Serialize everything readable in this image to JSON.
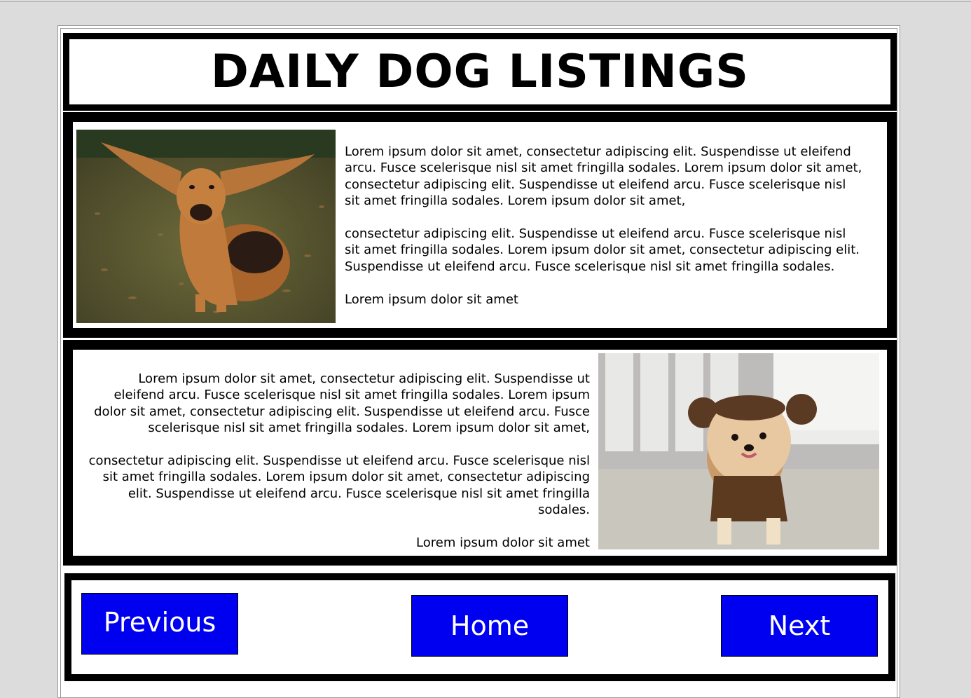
{
  "header": {
    "title": "DAILY DOG LISTINGS"
  },
  "listings": [
    {
      "image": "bloodhound-long-ears-photo",
      "paragraphs": [
        "Lorem ipsum dolor sit amet, consectetur adipiscing elit. Suspendisse ut eleifend arcu. Fusce scelerisque nisl sit amet fringilla sodales. Lorem ipsum dolor sit amet, consectetur adipiscing elit. Suspendisse ut eleifend arcu. Fusce scelerisque nisl sit amet fringilla sodales. Lorem ipsum dolor sit amet,",
        "consectetur adipiscing elit. Suspendisse ut eleifend arcu. Fusce scelerisque nisl sit amet fringilla sodales. Lorem ipsum dolor sit amet, consectetur adipiscing elit. Suspendisse ut eleifend arcu. Fusce scelerisque nisl sit amet fringilla sodales.",
        "Lorem ipsum dolor sit amet"
      ]
    },
    {
      "image": "pomeranian-in-costume-photo",
      "paragraphs": [
        "Lorem ipsum dolor sit amet, consectetur adipiscing elit. Suspendisse ut eleifend arcu. Fusce scelerisque nisl sit amet fringilla sodales. Lorem ipsum dolor sit amet, consectetur adipiscing elit. Suspendisse ut eleifend arcu. Fusce scelerisque nisl sit amet fringilla sodales. Lorem ipsum dolor sit amet,",
        "consectetur adipiscing elit. Suspendisse ut eleifend arcu. Fusce scelerisque nisl sit amet fringilla sodales. Lorem ipsum dolor sit amet, consectetur adipiscing elit. Suspendisse ut eleifend arcu. Fusce scelerisque nisl sit amet fringilla sodales.",
        "Lorem ipsum dolor sit amet"
      ]
    }
  ],
  "nav": {
    "previous_label": "Previous",
    "home_label": "Home",
    "next_label": "Next"
  },
  "colors": {
    "button": "#0000f0",
    "border": "#000000",
    "background": "#dcdcdc"
  }
}
